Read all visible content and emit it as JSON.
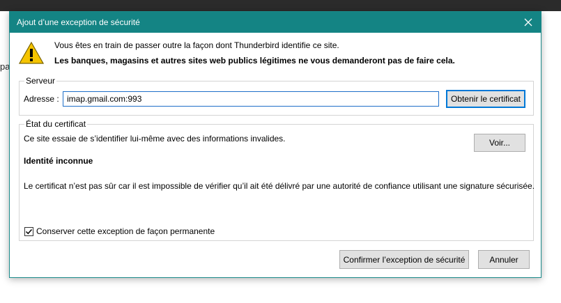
{
  "background": {
    "fragment_text": "pa"
  },
  "dialog": {
    "title": "Ajout d’une exception de sécurité",
    "warning_line1": "Vous êtes en train de passer outre la façon dont Thunderbird identifie ce site.",
    "warning_line2": "Les banques, magasins et autres sites web publics légitimes ne vous demanderont pas de faire cela.",
    "server": {
      "group_label": "Serveur",
      "address_label": "Adresse :",
      "address_value": "imap.gmail.com:993",
      "get_cert_button": "Obtenir le certificat"
    },
    "cert_status": {
      "group_label": "État du certificat",
      "line1": "Ce site essaie de s’identifier lui-même avec des informations invalides.",
      "view_button": "Voir...",
      "identity_title": "Identité inconnue",
      "detail": "Le certificat n’est pas sûr car il est impossible de vérifier qu’il ait été délivré par une autorité de confiance utilisant une signature sécurisée."
    },
    "permanent_checkbox": {
      "label": "Conserver cette exception de façon permanente",
      "checked": true
    },
    "buttons": {
      "confirm": "Confirmer l’exception de sécurité",
      "cancel": "Annuler"
    }
  },
  "colors": {
    "titlebar": "#148484",
    "focus_border": "#0078d7",
    "warning_yellow": "#f5c400"
  },
  "icons": {
    "warning": "warning-triangle-icon",
    "close": "close-icon",
    "check": "checkmark-icon"
  }
}
